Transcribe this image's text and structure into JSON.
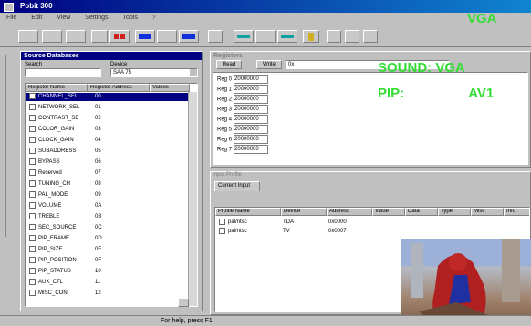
{
  "app": {
    "title": "Pobit 300"
  },
  "menu": [
    "File",
    "Edit",
    "View",
    "Settings",
    "Tools",
    "?"
  ],
  "overlay": {
    "mode": "VGA",
    "sound_label": "SOUND:",
    "sound_value": "VGA",
    "pip_label": "PIP:",
    "pip_value": "AV1"
  },
  "left_panel": {
    "title": "Source Databases",
    "search_label": "Search",
    "device_label": "Device",
    "device_value": "SAA 75",
    "columns": [
      "Register Name",
      "Register Address",
      "Values"
    ],
    "items": [
      {
        "name": "CHANNEL_SEL",
        "value": "00"
      },
      {
        "name": "NETWORK_SEL",
        "value": "01"
      },
      {
        "name": "CONTRAST_SE",
        "value": "02"
      },
      {
        "name": "COLOR_GAIN",
        "value": "03"
      },
      {
        "name": "CLOCK_GAIN",
        "value": "04"
      },
      {
        "name": "SUBADDRESS",
        "value": "05"
      },
      {
        "name": "BYPASS",
        "value": "06"
      },
      {
        "name": "Reserved",
        "value": "07"
      },
      {
        "name": "TUNING_CH",
        "value": "08"
      },
      {
        "name": "PAL_MODE",
        "value": "09"
      },
      {
        "name": "VOLUME",
        "value": "0A"
      },
      {
        "name": "TREBLE",
        "value": "0B"
      },
      {
        "name": "SEC_SOURCE",
        "value": "0C"
      },
      {
        "name": "PIP_FRAME",
        "value": "0D"
      },
      {
        "name": "PIP_SIZE",
        "value": "0E"
      },
      {
        "name": "PIP_POSITION",
        "value": "0F"
      },
      {
        "name": "PIP_STATUS",
        "value": "10"
      },
      {
        "name": "AUX_CTL",
        "value": "11"
      },
      {
        "name": "MISC_CON",
        "value": "12"
      }
    ]
  },
  "register_panel": {
    "title": "Registers",
    "buttons": [
      "Read",
      "Write"
    ],
    "field_value": "0x",
    "rows": [
      {
        "label": "Reg 0",
        "value": "20000000"
      },
      {
        "label": "Reg 1",
        "value": "20000000"
      },
      {
        "label": "Reg 2",
        "value": "20000000"
      },
      {
        "label": "Reg 3",
        "value": "20000000"
      },
      {
        "label": "Reg 4",
        "value": "20000000"
      },
      {
        "label": "Reg 5",
        "value": "20000000"
      },
      {
        "label": "Reg 6",
        "value": "20000000"
      },
      {
        "label": "Reg 7",
        "value": "20000000"
      }
    ]
  },
  "bottom_panel": {
    "title": "Input Profile",
    "tab": "Current Input",
    "columns": [
      "Profile Name",
      "Device",
      "Address",
      "Value",
      "Data",
      "Type",
      "Misc",
      "Info"
    ],
    "rows": [
      {
        "name": "pal/ntsc",
        "device": "TDA",
        "address": "0x0000"
      },
      {
        "name": "pal/ntsc",
        "device": "TV",
        "address": "0x0007"
      }
    ]
  },
  "status": {
    "text": "For help, press F1"
  },
  "colors": {
    "overlay_green": "#33dd33",
    "titlebar": "#000080"
  }
}
